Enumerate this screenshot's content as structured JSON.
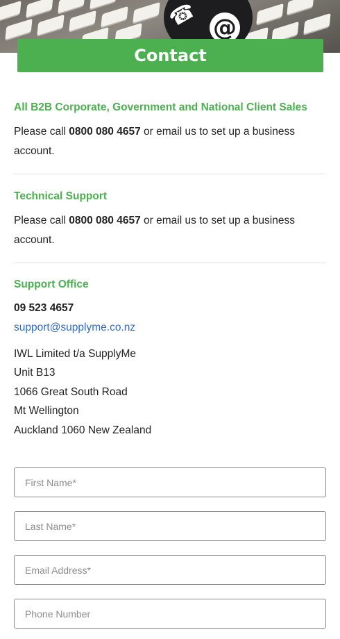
{
  "hero": {
    "icon_at": "@",
    "icon_phone": "☎",
    "banner_title": "Contact"
  },
  "sections": [
    {
      "heading": "All B2B Corporate, Government and National Client Sales",
      "text_before": "Please call ",
      "phone": "0800 080 4657",
      "text_after": " or email us to set up a business account."
    },
    {
      "heading": "Technical Support",
      "text_before": "Please call ",
      "phone": "0800 080 4657",
      "text_after": " or email us to set up a business account."
    }
  ],
  "support_office": {
    "heading": "Support Office",
    "phone": "09 523 4657",
    "email": "support@supplyme.co.nz",
    "address": [
      "IWL Limited t/a SupplyMe",
      "Unit B13",
      "1066 Great South Road",
      "Mt Wellington",
      "Auckland 1060 New Zealand"
    ]
  },
  "form": {
    "first_name_placeholder": "First Name*",
    "last_name_placeholder": "Last Name*",
    "email_placeholder": "Email Address*",
    "phone_placeholder": "Phone Number"
  },
  "colors": {
    "accent_green": "#4caf50",
    "link_blue": "#2f6cc4"
  }
}
